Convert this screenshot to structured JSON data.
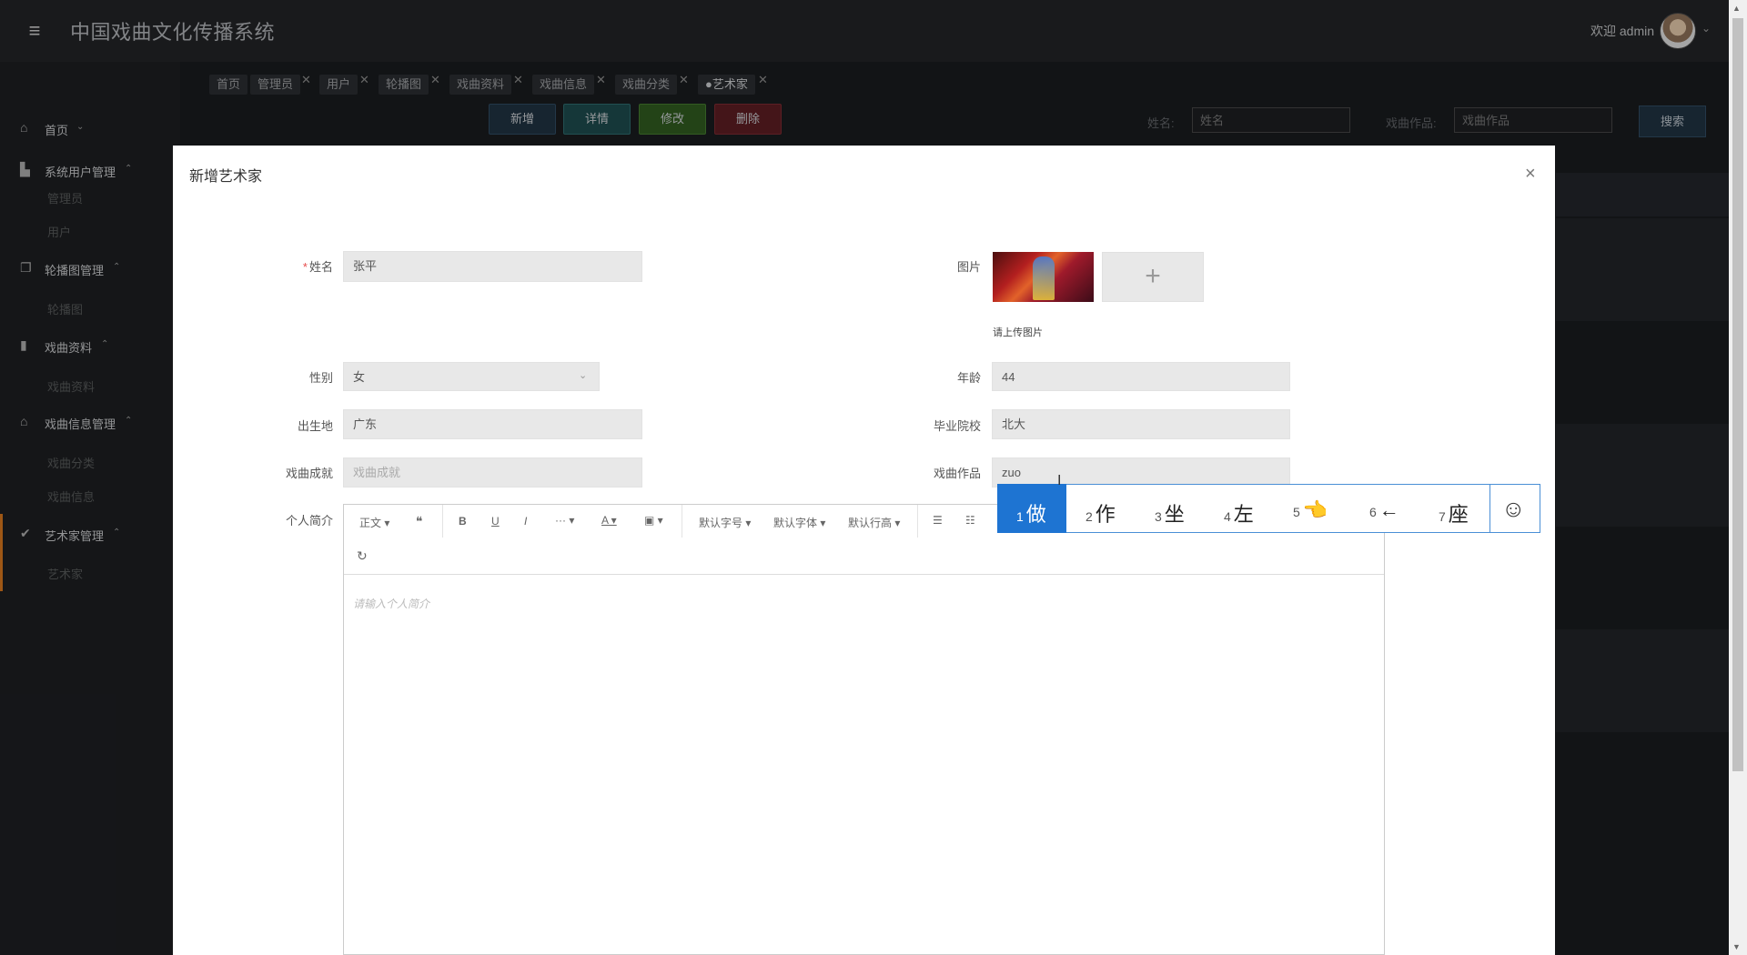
{
  "header": {
    "app_title": "中国戏曲文化传播系统",
    "welcome": "欢迎 admin"
  },
  "sidebar": {
    "items": [
      {
        "label": "首页",
        "icon": "home-icon"
      },
      {
        "label": "系统用户管理",
        "icon": "building-icon",
        "children": [
          "管理员",
          "用户"
        ]
      },
      {
        "label": "轮播图管理",
        "icon": "copy-icon",
        "children": [
          "轮播图"
        ]
      },
      {
        "label": "戏曲资料",
        "icon": "book-icon",
        "children": [
          "戏曲资料"
        ]
      },
      {
        "label": "戏曲信息管理",
        "icon": "bank-icon",
        "children": [
          "戏曲分类",
          "戏曲信息"
        ]
      },
      {
        "label": "艺术家管理",
        "icon": "check-circle-icon",
        "children": [
          "艺术家"
        ],
        "active": true
      }
    ]
  },
  "tabs": [
    "首页",
    "管理员",
    "用户",
    "轮播图",
    "戏曲资料",
    "戏曲信息",
    "戏曲分类",
    "●艺术家"
  ],
  "toolbar": {
    "add": "新增",
    "detail": "详情",
    "edit": "修改",
    "delete": "删除"
  },
  "search": {
    "name_label": "姓名:",
    "name_placeholder": "姓名",
    "works_label": "戏曲作品:",
    "works_placeholder": "戏曲作品",
    "button": "搜索"
  },
  "modal": {
    "title": "新增艺术家",
    "close": "×",
    "fields": {
      "name_label": "姓名",
      "name_value": "张平",
      "image_label": "图片",
      "upload_hint": "请上传图片",
      "gender_label": "性别",
      "gender_value": "女",
      "age_label": "年龄",
      "age_value": "44",
      "birthplace_label": "出生地",
      "birthplace_value": "广东",
      "school_label": "毕业院校",
      "school_value": "北大",
      "achievement_label": "戏曲成就",
      "achievement_placeholder": "戏曲成就",
      "works_label": "戏曲作品",
      "works_value": "zuo",
      "bio_label": "个人简介",
      "bio_placeholder": "请输入个人简介"
    },
    "editor_toolbar": {
      "paragraph": "正文",
      "font_size": "默认字号",
      "font_family": "默认字体",
      "line_height": "默认行高"
    }
  },
  "ime": {
    "candidates": [
      {
        "n": "1",
        "text": "做"
      },
      {
        "n": "2",
        "text": "作"
      },
      {
        "n": "3",
        "text": "坐"
      },
      {
        "n": "4",
        "text": "左"
      },
      {
        "n": "5",
        "text": "👈"
      },
      {
        "n": "6",
        "text": "←"
      },
      {
        "n": "7",
        "text": "座"
      }
    ]
  },
  "colors": {
    "accent_orange": "#d3741c",
    "ime_blue": "#1e74d2",
    "btn_add": "#1f3241",
    "btn_detail": "#1d4a4c",
    "btn_edit": "#2f5a1f",
    "btn_delete": "#5b1d22"
  }
}
